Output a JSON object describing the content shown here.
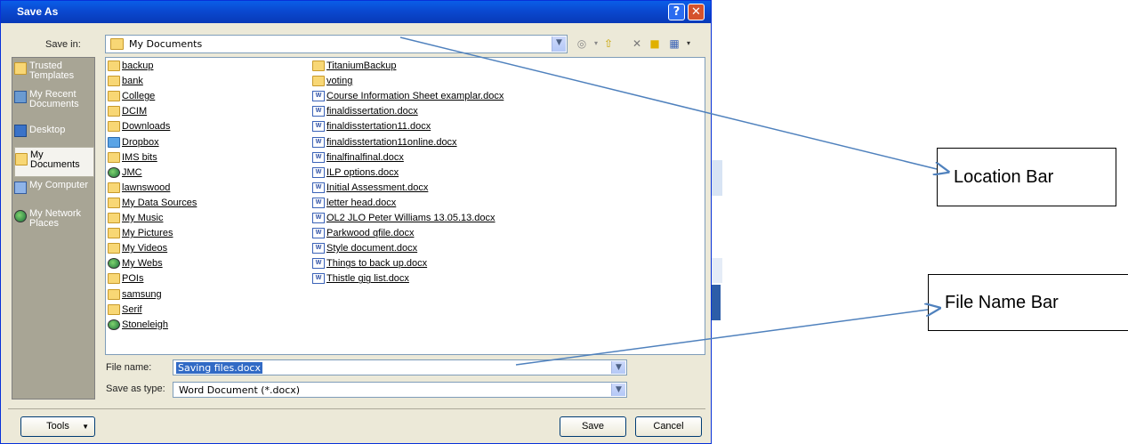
{
  "dialog": {
    "title": "Save As",
    "help_label": "?",
    "close_label": "✕"
  },
  "save_in": {
    "label": "Save in:",
    "value": "My Documents"
  },
  "places": [
    {
      "label": "Trusted Templates",
      "icon": "folder-icon"
    },
    {
      "label": "My Recent Documents",
      "icon": "recent-documents-icon"
    },
    {
      "label": "Desktop",
      "icon": "desktop-icon"
    },
    {
      "label": "My Documents",
      "icon": "my-documents-icon",
      "selected": true
    },
    {
      "label": "My Computer",
      "icon": "computer-icon"
    },
    {
      "label": "My Network Places",
      "icon": "network-places-icon"
    }
  ],
  "files": {
    "column1": [
      {
        "name": "backup",
        "type": "folder"
      },
      {
        "name": "bank",
        "type": "folder"
      },
      {
        "name": "College",
        "type": "folder"
      },
      {
        "name": "DCIM",
        "type": "folder"
      },
      {
        "name": "Downloads",
        "type": "folder"
      },
      {
        "name": "Dropbox",
        "type": "dropbox"
      },
      {
        "name": "IMS bits",
        "type": "folder"
      },
      {
        "name": "JMC",
        "type": "globe"
      },
      {
        "name": "lawnswood",
        "type": "folder"
      },
      {
        "name": "My Data Sources",
        "type": "folder"
      },
      {
        "name": "My Music",
        "type": "folder"
      },
      {
        "name": "My Pictures",
        "type": "folder"
      },
      {
        "name": "My Videos",
        "type": "folder"
      },
      {
        "name": "My Webs",
        "type": "globe"
      },
      {
        "name": "POIs",
        "type": "folder"
      },
      {
        "name": "samsung",
        "type": "folder"
      },
      {
        "name": "Serif",
        "type": "folder"
      },
      {
        "name": "Stoneleigh",
        "type": "globe"
      }
    ],
    "column2": [
      {
        "name": "TitaniumBackup",
        "type": "folder"
      },
      {
        "name": "voting",
        "type": "folder"
      },
      {
        "name": "Course Information Sheet examplar.docx",
        "type": "doc"
      },
      {
        "name": "finaldissertation.docx",
        "type": "doc"
      },
      {
        "name": "finaldisstertation11.docx",
        "type": "doc"
      },
      {
        "name": "finaldisstertation11online.docx",
        "type": "doc"
      },
      {
        "name": "finalfinalfinal.docx",
        "type": "doc"
      },
      {
        "name": "ILP options.docx",
        "type": "doc"
      },
      {
        "name": "Initial Assessment.docx",
        "type": "doc"
      },
      {
        "name": "letter head.docx",
        "type": "doc"
      },
      {
        "name": "OL2 JLO Peter Williams 13.05.13.docx",
        "type": "doc"
      },
      {
        "name": "Parkwood qfile.docx",
        "type": "doc"
      },
      {
        "name": "Style document.docx",
        "type": "doc"
      },
      {
        "name": "Things to back up.docx",
        "type": "doc"
      },
      {
        "name": "Thistle gig list.docx",
        "type": "doc"
      }
    ]
  },
  "file_name": {
    "label": "File name:",
    "value": "Saving files.docx"
  },
  "save_type": {
    "label": "Save as type:",
    "value": "Word Document (*.docx)"
  },
  "buttons": {
    "tools": "Tools",
    "save": "Save",
    "cancel": "Cancel"
  },
  "annotations": {
    "location_bar": "Location Bar",
    "file_name_bar": "File Name Bar"
  },
  "colors": {
    "title_bar": "#0a49d0",
    "dialog_bg": "#ece9d8",
    "places_bg": "#a8a595",
    "arrow": "#4f81bd"
  }
}
